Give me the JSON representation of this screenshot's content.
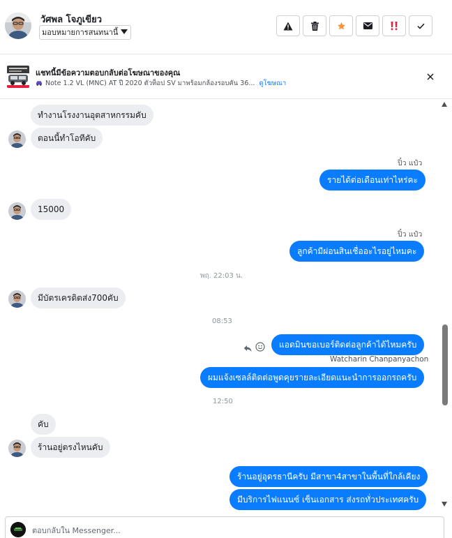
{
  "header": {
    "user_name": "วัศพล โจภูเขียว",
    "assign_label": "มอบหมายการสนทนานี้",
    "tools": [
      {
        "name": "spam-button",
        "icon": "warning-triangle-icon"
      },
      {
        "name": "delete-button",
        "icon": "trash-icon"
      },
      {
        "name": "star-button",
        "icon": "star-icon"
      },
      {
        "name": "mark-unread-button",
        "icon": "envelope-icon"
      },
      {
        "name": "follow-up-button",
        "icon": "priority-icon"
      },
      {
        "name": "mark-done-button",
        "icon": "checkmark-icon"
      }
    ],
    "colors": {
      "star": "#f7923b",
      "priority": "#e41e3f"
    }
  },
  "ad": {
    "title": "แชทนี้มีข้อความตอบกลับต่อโฆษณาของคุณ",
    "description": "Note 1.2 VL (MNC) AT ปี 2020 ตัวท็อป SV มาพร้อมกล้องรอบคัน 36...",
    "link_text": "ดูโฆษณา"
  },
  "messages": [
    {
      "kind": "in",
      "text": "ทำงานโรงงานอุตสาหกรรมคับ"
    },
    {
      "kind": "in",
      "text": "ตอนนี้ทำโอทีคับ"
    },
    {
      "kind": "sender",
      "text": "ปิ๋ว แป๋ว"
    },
    {
      "kind": "out",
      "text": "รายได้ต่อเดือนเท่าไหร่คะ"
    },
    {
      "kind": "in",
      "text": "15000"
    },
    {
      "kind": "sender",
      "text": "ปิ๋ว แป๋ว"
    },
    {
      "kind": "out",
      "text": "ลูกค้ามีผ่อนสินเชื่ออะไรอยู่ไหมคะ"
    },
    {
      "kind": "time",
      "text": "พฤ. 22:03 น."
    },
    {
      "kind": "in",
      "text": "มีบัตรเครดิตส่ง700คับ"
    },
    {
      "kind": "time",
      "text": "08:53"
    },
    {
      "kind": "out",
      "text": "แอดมินขอเบอร์ติดต่อลูกค้าได้ไหมครับ"
    },
    {
      "kind": "sender",
      "text": "Watcharin Chanpanyachon"
    },
    {
      "kind": "out",
      "text": "ผมแจ้งเซลล์ติดต่อพูดคุยรายละเอียดแนะนำการออกรถครับ"
    },
    {
      "kind": "time",
      "text": "12:50"
    },
    {
      "kind": "in",
      "text": "คับ"
    },
    {
      "kind": "in",
      "text": "ร้านอยู่ตรงไหนคับ"
    },
    {
      "kind": "out",
      "text": "ร้านอยู่อุดรธานีครับ มีสาขา4สาขาในพื้นที่ใกล้เคียง"
    },
    {
      "kind": "out",
      "text": "มีบริการไฟแนนซ์ เซ็นเอกสาร ส่งรถทั่วประเทศครับ"
    }
  ],
  "composer": {
    "placeholder": "ตอบกลับใน Messenger..."
  },
  "colors": {
    "outgoing_bubble": "#0a7cff",
    "incoming_bubble": "#ebedf0",
    "link": "#1877f2"
  }
}
